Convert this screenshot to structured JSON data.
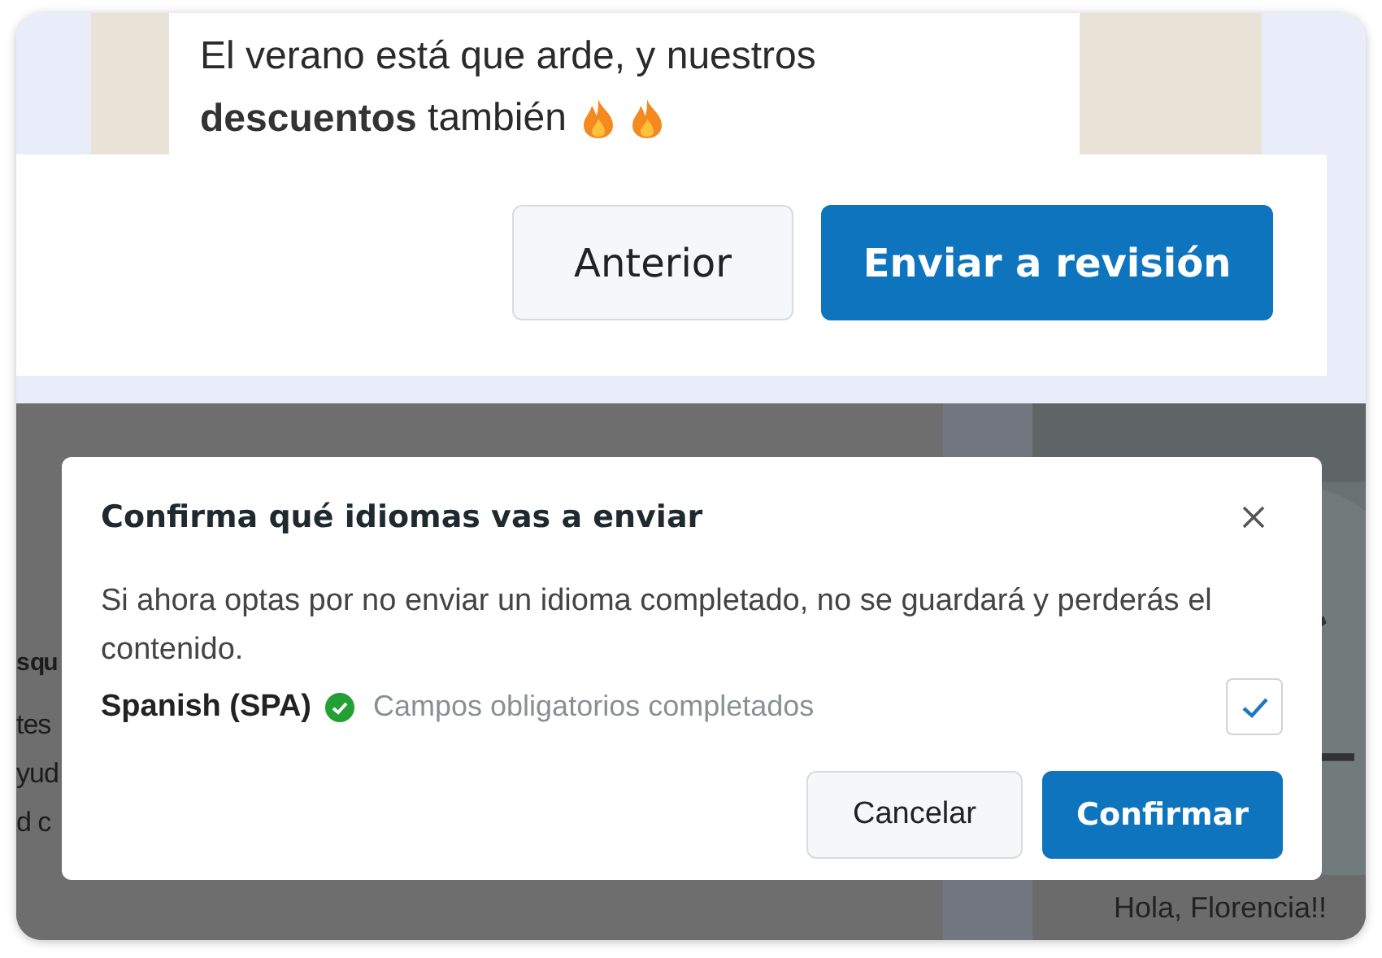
{
  "preview": {
    "message_lines": [
      "El verano está que arde, y nuestros",
      "**descuentos** también"
    ]
  },
  "footer": {
    "buttons": [
      {
        "label": "Anterior",
        "kind": "secondary"
      },
      {
        "label": "Enviar a revisión",
        "kind": "primary"
      }
    ]
  },
  "background": {
    "left_fragments": [
      {
        "text": "s qu",
        "bold": true
      },
      {
        "text": "tes",
        "bold": false
      },
      {
        "text": "yud",
        "bold": false
      },
      {
        "text": "d c",
        "bold": false
      }
    ],
    "right_text": "Hola, Florencia!!"
  },
  "dialog": {
    "title": "Confirma qué idiomas vas a enviar",
    "message": "Si ahora optas por no enviar un idioma completado, no se guardará y perderás el contenido.",
    "languages": [
      {
        "name": "Spanish (SPA)",
        "complete": true,
        "status": "Campos obligatorios completados",
        "checked": true
      }
    ],
    "buttons": [
      {
        "label": "Cancelar",
        "kind": "secondary"
      },
      {
        "label": "Confirmar",
        "kind": "primary"
      }
    ]
  }
}
